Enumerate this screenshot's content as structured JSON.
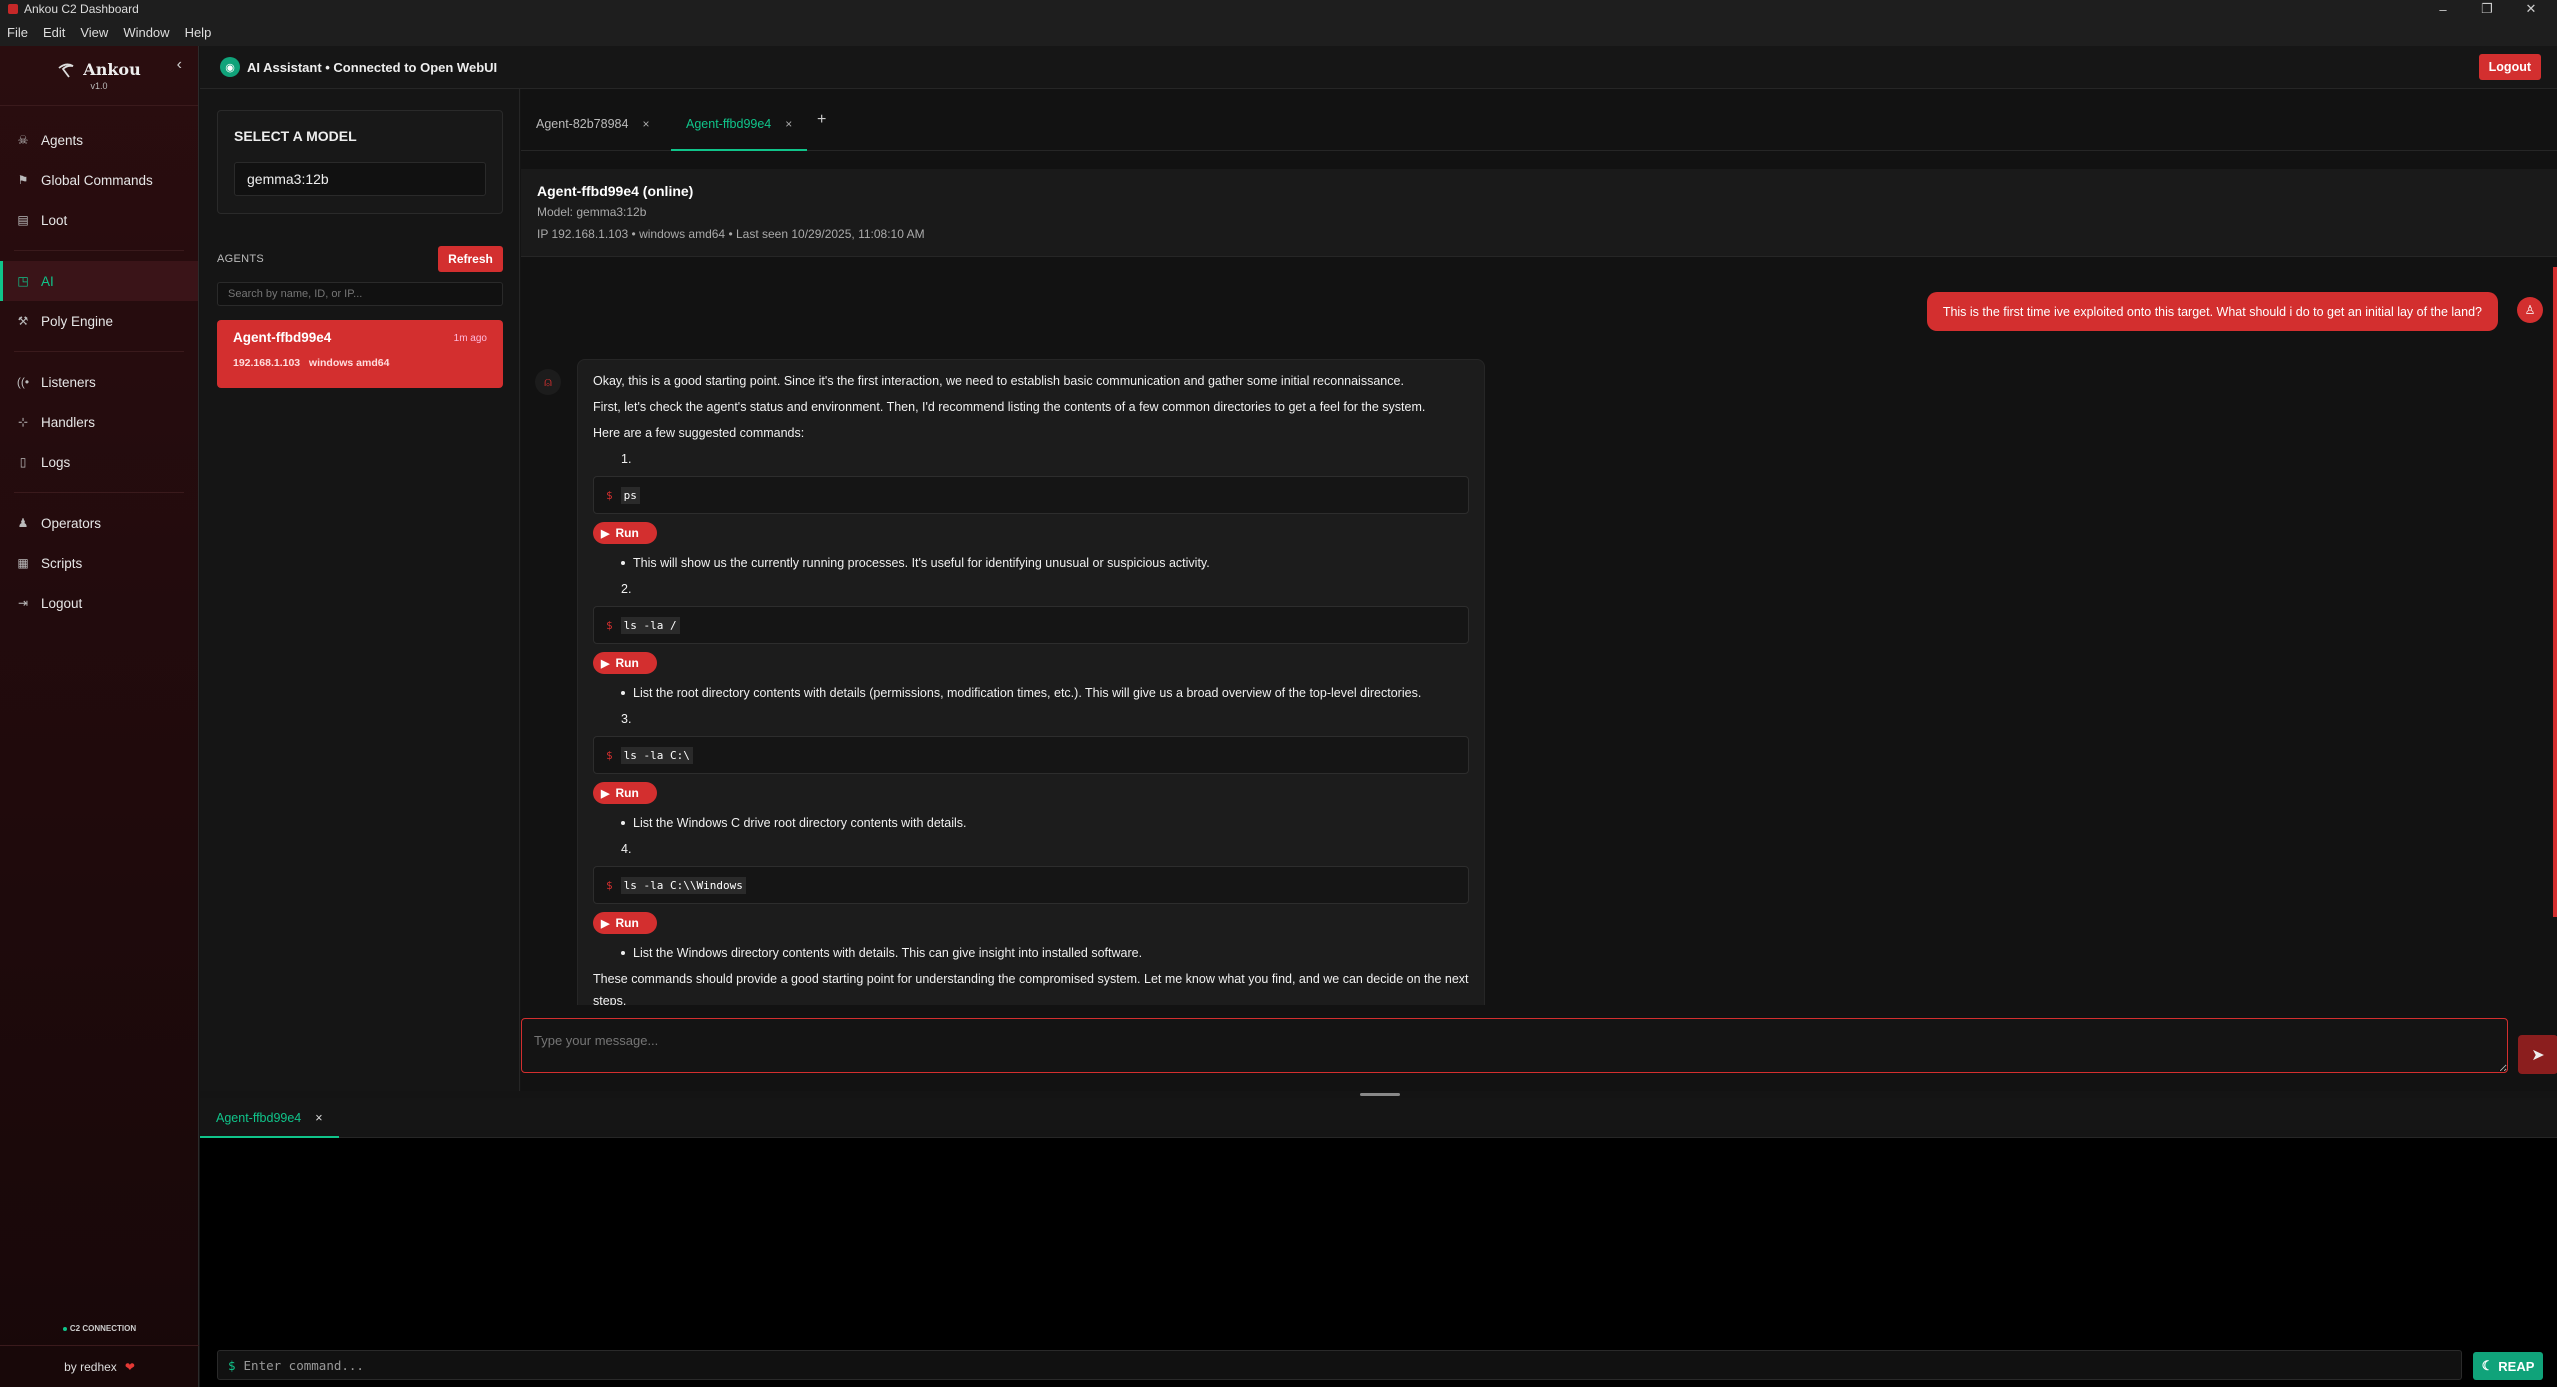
{
  "window": {
    "title": "Ankou C2 Dashboard"
  },
  "menu": [
    "File",
    "Edit",
    "View",
    "Window",
    "Help"
  ],
  "brand": {
    "name": "Ankou",
    "version": "v1.0"
  },
  "nav": {
    "items": [
      {
        "label": "Agents",
        "icon": "skull-icon"
      },
      {
        "label": "Global Commands",
        "icon": "broadcast-icon"
      },
      {
        "label": "Loot",
        "icon": "database-icon"
      },
      {
        "label": "AI",
        "icon": "robot-icon"
      },
      {
        "label": "Poly Engine",
        "icon": "build-icon"
      },
      {
        "label": "Listeners",
        "icon": "antenna-icon"
      },
      {
        "label": "Handlers",
        "icon": "network-icon"
      },
      {
        "label": "Logs",
        "icon": "file-icon"
      },
      {
        "label": "Operators",
        "icon": "user-icon"
      },
      {
        "label": "Scripts",
        "icon": "script-icon"
      },
      {
        "label": "Logout",
        "icon": "logout-icon"
      }
    ],
    "active": "AI"
  },
  "connection": {
    "label": "C2 CONNECTION"
  },
  "footer": {
    "byline": "by redhex"
  },
  "topbar": {
    "title": "AI Assistant • Connected to Open WebUI",
    "logout": "Logout"
  },
  "model": {
    "heading": "SELECT A MODEL",
    "selected": "gemma3:12b"
  },
  "agents_panel": {
    "heading": "AGENTS",
    "refresh": "Refresh",
    "search_placeholder": "Search by name, ID, or IP...",
    "list": [
      {
        "name": "Agent-ffbd99e4",
        "ago": "1m ago",
        "ip": "192.168.1.103",
        "os": "windows amd64"
      }
    ]
  },
  "chat_tabs": [
    {
      "label": "Agent-82b78984",
      "active": false
    },
    {
      "label": "Agent-ffbd99e4",
      "active": true
    }
  ],
  "agent_header": {
    "title": "Agent-ffbd99e4 (online)",
    "model": "Model: gemma3:12b",
    "info": "IP 192.168.1.103 • windows amd64 • Last seen 10/29/2025, 11:08:10 AM"
  },
  "user_message": "This is the first time ive exploited onto this target. What should i do to get an initial lay of the land?",
  "ai_message": {
    "p1": "Okay, this is a good starting point. Since it's the first interaction, we need to establish basic communication and gather some initial reconnaissance.",
    "p2": "First, let's check the agent's status and environment. Then, I'd recommend listing the contents of a few common directories to get a feel for the system.",
    "p3": "Here are a few suggested commands:",
    "run_label": "Run",
    "commands": [
      {
        "num": "1.",
        "cmd": "ps",
        "desc": "This will show us the currently running processes. It's useful for identifying unusual or suspicious activity."
      },
      {
        "num": "2.",
        "cmd": "ls -la /",
        "desc": "List the root directory contents with details (permissions, modification times, etc.). This will give us a broad overview of the top-level directories."
      },
      {
        "num": "3.",
        "cmd": "ls -la C:\\",
        "desc": "List the Windows C drive root directory contents with details."
      },
      {
        "num": "4.",
        "cmd": "ls -la C:\\\\Windows",
        "desc": "List the Windows directory contents with details. This can give insight into installed software."
      }
    ],
    "closing": "These commands should provide a good starting point for understanding the compromised system. Let me know what you find, and we can decide on the next steps."
  },
  "composer": {
    "placeholder": "Type your message..."
  },
  "terminal": {
    "tab": "Agent-ffbd99e4",
    "placeholder": "Enter command...",
    "prompt": "$",
    "reap": "REAP"
  },
  "colors": {
    "accent_red": "#d32f2f",
    "accent_green": "#10c48a"
  }
}
